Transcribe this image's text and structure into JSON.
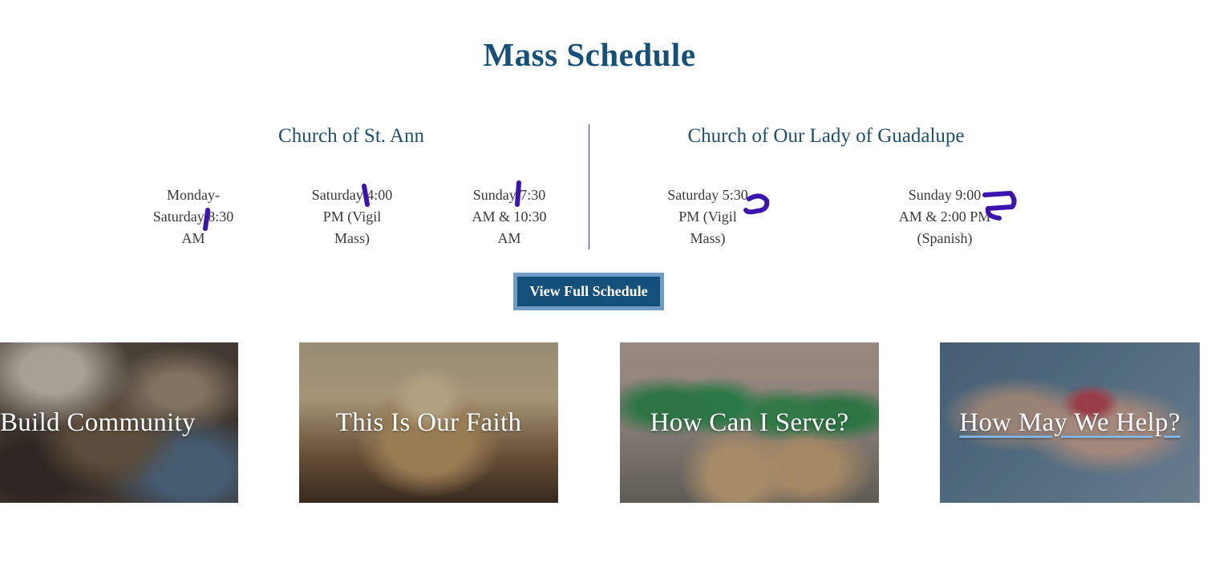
{
  "title": "Mass Schedule",
  "churches": [
    {
      "name": "Church of St. Ann",
      "times": [
        [
          "Monday-",
          "Saturday 8:30",
          "AM"
        ],
        [
          "Saturday 4:00",
          "PM (Vigil",
          "Mass)"
        ],
        [
          "Sunday 7:30",
          "AM & 10:30",
          "AM"
        ]
      ]
    },
    {
      "name": "Church of Our Lady of Guadalupe",
      "times": [
        [
          "Saturday 5:30",
          "PM (Vigil",
          "Mass)"
        ],
        [
          "Sunday 9:00",
          "AM & 2:00 PM",
          "(Spanish)"
        ]
      ]
    }
  ],
  "button": {
    "label": "View Full Schedule"
  },
  "cards": [
    {
      "label": "Build Community"
    },
    {
      "label": "This Is Our Faith"
    },
    {
      "label": "How Can I Serve?"
    },
    {
      "label": "How May We Help?"
    }
  ],
  "colors": {
    "title": "#14507a",
    "button_bg": "#14507a",
    "button_border": "#6e9cc4",
    "annotation_marks": "#3b13b0"
  }
}
